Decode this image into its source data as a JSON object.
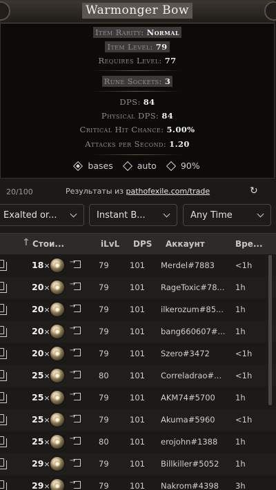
{
  "tooltip": {
    "title": "Warmonger Bow",
    "item_rarity_label": "Item Rarity:",
    "item_rarity_value": "Normal",
    "item_level_label": "Item Level:",
    "item_level_value": "79",
    "req_level_label": "Requires Level:",
    "req_level_value": "77",
    "rune_sockets_label": "Rune Sockets:",
    "rune_sockets_value": "3",
    "dps_label": "DPS:",
    "dps_value": "84",
    "phys_dps_label": "Physical DPS:",
    "phys_dps_value": "84",
    "crit_label": "Critical Hit Chance:",
    "crit_value": "5.00%",
    "aps_label": "Attacks per Second:",
    "aps_value": "1.20",
    "options": [
      {
        "label": "bases",
        "selected": true
      },
      {
        "label": "auto",
        "selected": false
      },
      {
        "label": "90%",
        "selected": false
      }
    ]
  },
  "results": {
    "count": "20/100",
    "source_prefix": "Результаты из ",
    "source_link": "pathofexile.com/trade",
    "refresh_icon": "refresh-icon"
  },
  "filters": {
    "currency": "Exalted or...",
    "listing": "Instant B...",
    "time": "Any Time"
  },
  "table": {
    "headers": {
      "price": "Стои...",
      "ilvl": "iLvL",
      "dps": "DPS",
      "account": "Аккаунт",
      "time": "Вре..."
    },
    "rows": [
      {
        "qty": "18",
        "ilvl": "79",
        "dps": "101",
        "account": "Merdel#7883",
        "time": "<1h"
      },
      {
        "qty": "20",
        "ilvl": "79",
        "dps": "101",
        "account": "RageToxic#78...",
        "time": "1h"
      },
      {
        "qty": "20",
        "ilvl": "79",
        "dps": "101",
        "account": "ilkerozum#85...",
        "time": "1h"
      },
      {
        "qty": "20",
        "ilvl": "79",
        "dps": "101",
        "account": "bang660607#...",
        "time": "1h"
      },
      {
        "qty": "20",
        "ilvl": "79",
        "dps": "101",
        "account": "Szero#3472",
        "time": "<1h"
      },
      {
        "qty": "25",
        "ilvl": "80",
        "dps": "101",
        "account": "Correladrao#...",
        "time": "<1h"
      },
      {
        "qty": "25",
        "ilvl": "79",
        "dps": "101",
        "account": "AKM74#5700",
        "time": "1h"
      },
      {
        "qty": "25",
        "ilvl": "79",
        "dps": "101",
        "account": "Akuma#5960",
        "time": "<1h"
      },
      {
        "qty": "25",
        "ilvl": "80",
        "dps": "101",
        "account": "erojohn#1388",
        "time": "1h"
      },
      {
        "qty": "29",
        "ilvl": "79",
        "dps": "101",
        "account": "Billkiller#5052",
        "time": "1h"
      },
      {
        "qty": "29",
        "ilvl": "79",
        "dps": "101",
        "account": "Nakrom#4398",
        "time": "3h"
      }
    ],
    "multiplier": "×"
  }
}
